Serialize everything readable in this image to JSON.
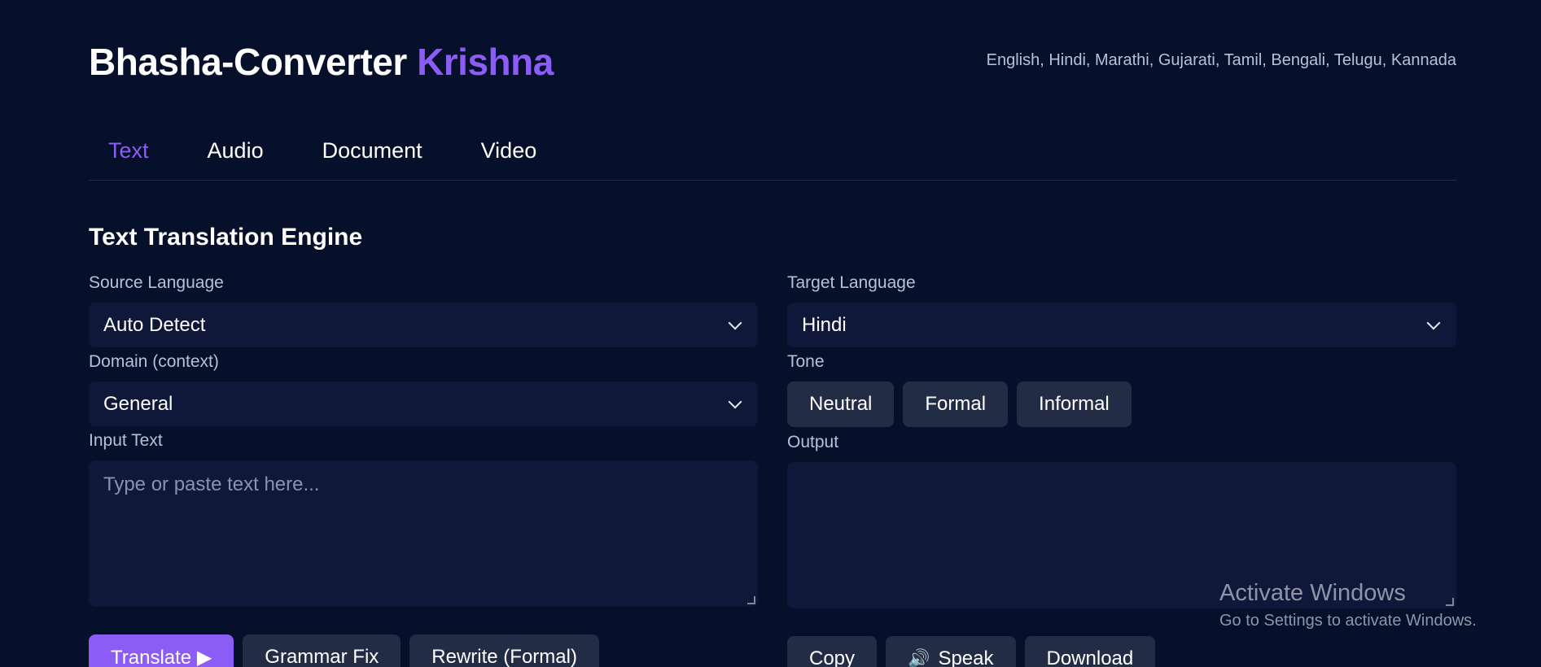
{
  "header": {
    "brand_main": "Bhasha-Converter",
    "brand_accent": "Krishna",
    "languages": "English, Hindi, Marathi, Gujarati, Tamil, Bengali, Telugu, Kannada"
  },
  "tabs": [
    {
      "label": "Text",
      "active": true
    },
    {
      "label": "Audio",
      "active": false
    },
    {
      "label": "Document",
      "active": false
    },
    {
      "label": "Video",
      "active": false
    }
  ],
  "engine": {
    "title": "Text Translation Engine",
    "source_language": {
      "label": "Source Language",
      "value": "Auto Detect"
    },
    "target_language": {
      "label": "Target Language",
      "value": "Hindi"
    },
    "domain": {
      "label": "Domain (context)",
      "value": "General"
    },
    "tone": {
      "label": "Tone",
      "options": [
        "Neutral",
        "Formal",
        "Informal"
      ]
    },
    "input": {
      "label": "Input Text",
      "placeholder": "Type or paste text here...",
      "value": ""
    },
    "output": {
      "label": "Output",
      "value": ""
    },
    "left_actions": [
      "Translate ▶",
      "Grammar Fix",
      "Rewrite (Formal)"
    ],
    "right_actions": {
      "copy": "Copy",
      "speak": "Speak",
      "download": "Download"
    }
  },
  "watermark": {
    "title": "Activate Windows",
    "subtitle": "Go to Settings to activate Windows."
  },
  "colors": {
    "background": "#07102a",
    "panel": "#0f1839",
    "button": "#232c45",
    "accent": "#8b5cf6"
  },
  "icons": {
    "speak": "speaker-icon",
    "dropdown": "chevron-down-icon"
  }
}
